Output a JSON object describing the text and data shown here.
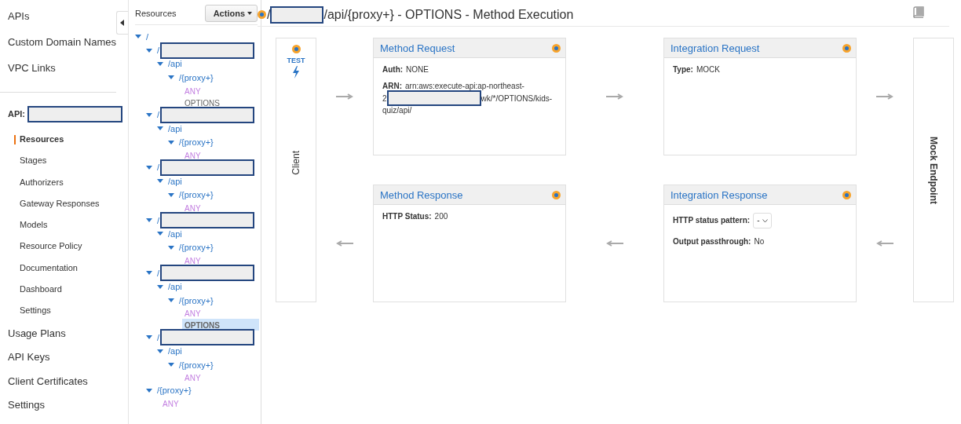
{
  "nav": {
    "top": [
      {
        "label": "APIs"
      },
      {
        "label": "Custom Domain Names"
      },
      {
        "label": "VPC Links"
      }
    ],
    "api_label": "API:",
    "api_name_redacted": true,
    "api_items": [
      {
        "label": "Resources",
        "selected": true
      },
      {
        "label": "Stages",
        "selected": false
      },
      {
        "label": "Authorizers",
        "selected": false
      },
      {
        "label": "Gateway Responses",
        "selected": false
      },
      {
        "label": "Models",
        "selected": false
      },
      {
        "label": "Resource Policy",
        "selected": false
      },
      {
        "label": "Documentation",
        "selected": false
      },
      {
        "label": "Dashboard",
        "selected": false
      },
      {
        "label": "Settings",
        "selected": false
      }
    ],
    "bottom": [
      {
        "label": "Usage Plans"
      },
      {
        "label": "API Keys"
      },
      {
        "label": "Client Certificates"
      },
      {
        "label": "Settings"
      }
    ]
  },
  "resources": {
    "title": "Resources",
    "actions": "Actions",
    "tree": [
      {
        "label": "/",
        "expanded": true,
        "children": [
          {
            "label": "/",
            "redacted": true,
            "expanded": true,
            "children": [
              {
                "label": "/api",
                "expanded": true,
                "children": [
                  {
                    "label": "/{proxy+}",
                    "expanded": true,
                    "children": [
                      {
                        "kind": "method",
                        "label": "ANY",
                        "color": "#c27ee0",
                        "selected": false
                      },
                      {
                        "kind": "method",
                        "label": "OPTIONS",
                        "color": "#666666",
                        "selected": false
                      }
                    ]
                  }
                ]
              }
            ]
          },
          {
            "label": "/",
            "redacted": true,
            "expanded": true,
            "children": [
              {
                "label": "/api",
                "expanded": true,
                "children": [
                  {
                    "label": "/{proxy+}",
                    "expanded": true,
                    "children": [
                      {
                        "kind": "method",
                        "label": "ANY",
                        "color": "#c27ee0",
                        "selected": false
                      }
                    ]
                  }
                ]
              }
            ]
          },
          {
            "label": "/",
            "redacted": true,
            "expanded": true,
            "children": [
              {
                "label": "/api",
                "expanded": true,
                "children": [
                  {
                    "label": "/{proxy+}",
                    "expanded": true,
                    "children": [
                      {
                        "kind": "method",
                        "label": "ANY",
                        "color": "#c27ee0",
                        "selected": false
                      }
                    ]
                  }
                ]
              }
            ]
          },
          {
            "label": "/",
            "redacted": true,
            "expanded": true,
            "children": [
              {
                "label": "/api",
                "expanded": true,
                "children": [
                  {
                    "label": "/{proxy+}",
                    "expanded": true,
                    "children": [
                      {
                        "kind": "method",
                        "label": "ANY",
                        "color": "#c27ee0",
                        "selected": false
                      }
                    ]
                  }
                ]
              }
            ]
          },
          {
            "label": "/",
            "redacted": true,
            "expanded": true,
            "children": [
              {
                "label": "/api",
                "expanded": true,
                "children": [
                  {
                    "label": "/{proxy+}",
                    "expanded": true,
                    "children": [
                      {
                        "kind": "method",
                        "label": "ANY",
                        "color": "#c27ee0",
                        "selected": false
                      },
                      {
                        "kind": "method",
                        "label": "OPTIONS",
                        "color": "#666666",
                        "selected": true
                      }
                    ]
                  }
                ]
              }
            ]
          },
          {
            "label": "/",
            "redacted": true,
            "expanded": true,
            "children": [
              {
                "label": "/api",
                "expanded": true,
                "children": [
                  {
                    "label": "/{proxy+}",
                    "expanded": true,
                    "children": [
                      {
                        "kind": "method",
                        "label": "ANY",
                        "color": "#c27ee0",
                        "selected": false
                      }
                    ]
                  }
                ]
              }
            ]
          },
          {
            "label": "/{proxy+}",
            "expanded": true,
            "children": [
              {
                "kind": "method",
                "label": "ANY",
                "color": "#c27ee0",
                "selected": false
              }
            ]
          }
        ]
      }
    ]
  },
  "title": {
    "prefix": "/",
    "redacted": true,
    "suffix": "/api/{proxy+} - OPTIONS - Method Execution"
  },
  "client": {
    "test": "TEST",
    "label": "Client"
  },
  "cards": [
    {
      "title": "Method Request",
      "fields": [
        {
          "kind": "text",
          "label": "Auth:",
          "value": "NONE"
        },
        {
          "kind": "arn",
          "label": "ARN:",
          "line1": "arn:aws:execute-api:ap-northeast-",
          "before": "2",
          "after": "wk/*/OPTIONS/kids-",
          "line3": "quiz/api/"
        }
      ]
    },
    {
      "title": "Integration Request",
      "fields": [
        {
          "kind": "text",
          "label": "Type:",
          "value": "MOCK"
        }
      ]
    },
    {
      "title": "Method Response",
      "fields": [
        {
          "kind": "text",
          "label": "HTTP Status:",
          "value": "200"
        }
      ]
    },
    {
      "title": "Integration Response",
      "fields": [
        {
          "kind": "select",
          "label": "HTTP status pattern:",
          "value": "-"
        },
        {
          "kind": "text",
          "label": "Output passthrough:",
          "value": "No"
        }
      ]
    }
  ],
  "endpoint": {
    "label": "Mock Endpoint"
  }
}
